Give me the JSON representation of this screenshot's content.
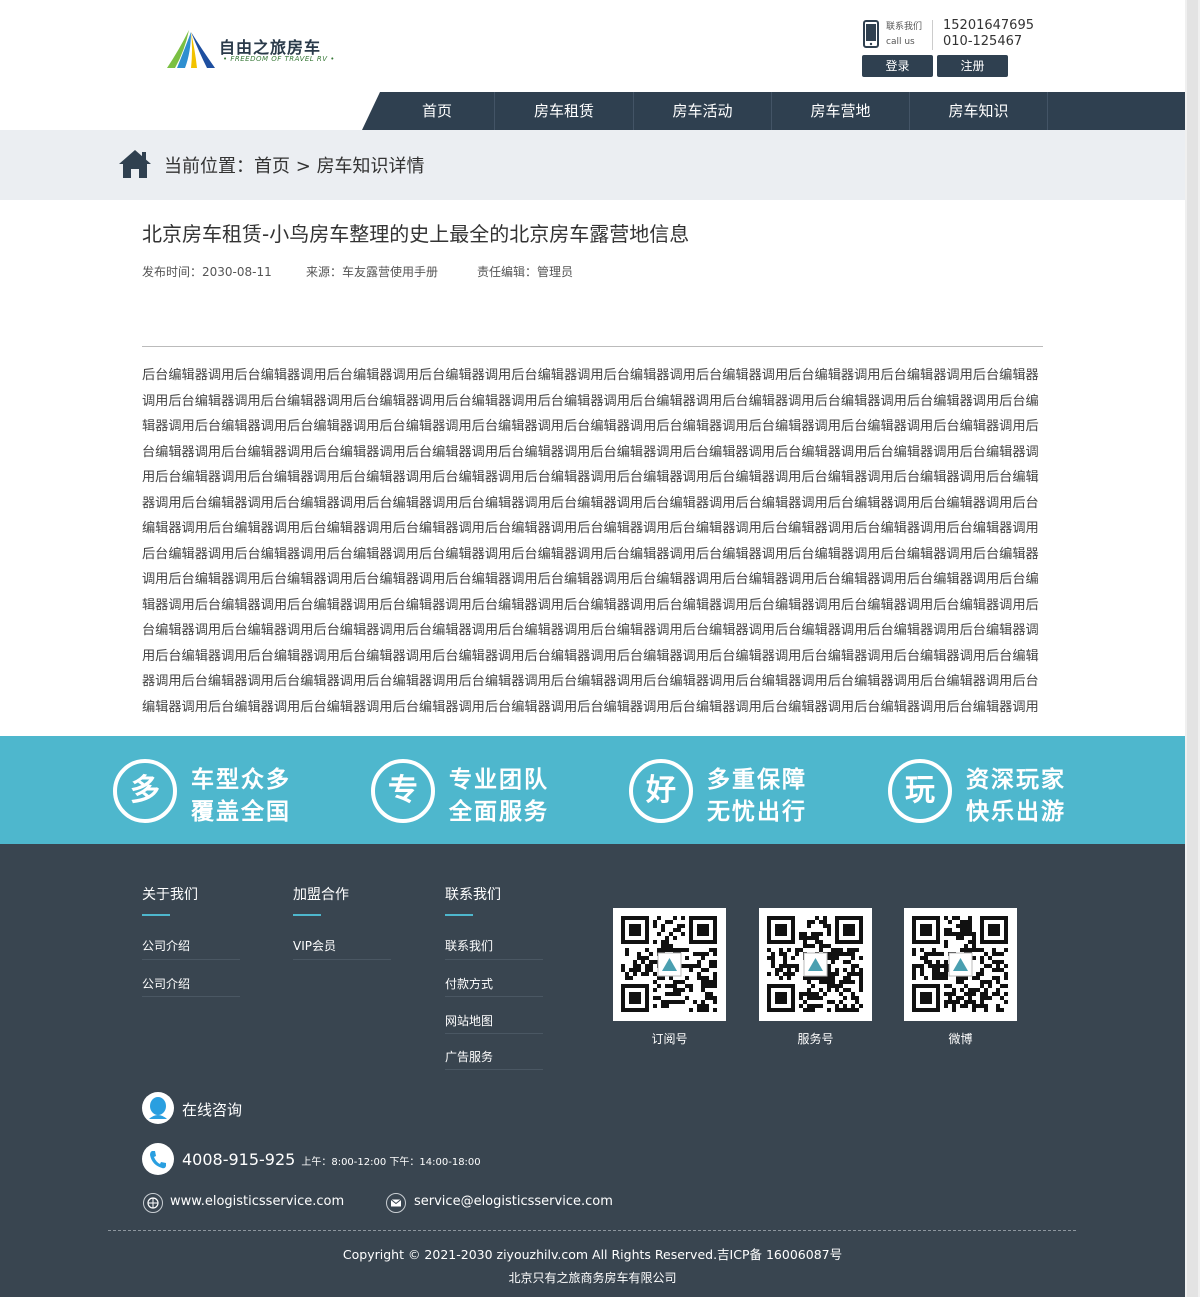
{
  "header": {
    "logo_text": "自由之旅房车",
    "logo_sub": "• FREEDOM OF TRAVEL RV •",
    "contact_label_cn": "联系我们",
    "contact_label_en": "call us",
    "phone1": "15201647695",
    "phone2": "010-125467",
    "login": "登录",
    "register": "注册"
  },
  "nav": {
    "items": [
      "首页",
      "房车租赁",
      "房车活动",
      "房车营地",
      "房车知识"
    ]
  },
  "breadcrumb": {
    "prefix": "当前位置：",
    "home": "首页",
    "sep": ">",
    "current": "房车知识详情"
  },
  "article": {
    "title": "北京房车租赁-小鸟房车整理的史上最全的北京房车露营地信息",
    "published": "发布时间：2030-08-11",
    "source": "来源：车友露营使用手册",
    "editor": "责任编辑：管理员",
    "body": "后台编辑器调用后台编辑器调用后台编辑器调用后台编辑器调用后台编辑器调用后台编辑器调用后台编辑器调用后台编辑器调用后台编辑器调用后台编辑器调用后台编辑器调用后台编辑器调用后台编辑器调用后台编辑器调用后台编辑器调用后台编辑器调用后台编辑器调用后台编辑器调用后台编辑器调用后台编辑器调用后台编辑器调用后台编辑器调用后台编辑器调用后台编辑器调用后台编辑器调用后台编辑器调用后台编辑器调用后台编辑器调用后台编辑器调用后台编辑器调用后台编辑器调用后台编辑器调用后台编辑器调用后台编辑器调用后台编辑器调用后台编辑器调用后台编辑器调用后台编辑器调用后台编辑器调用后台编辑器调用后台编辑器调用后台编辑器调用后台编辑器调用后台编辑器调用后台编辑器调用后台编辑器调用后台编辑器调用后台编辑器调用后台编辑器调用后台编辑器调用后台编辑器调用后台编辑器调用后台编辑器调用后台编辑器调用后台编辑器调用后台编辑器调用后台编辑器调用后台编辑器调用后台编辑器调用后台编辑器调用后台编辑器调用后台编辑器调用后台编辑器调用后台编辑器调用后台编辑器调用后台编辑器调用后台编辑器调用后台编辑器调用后台编辑器调用后台编辑器调用后台编辑器调用后台编辑器调用后台编辑器调用后台编辑器调用后台编辑器调用后台编辑器调用后台编辑器调用后台编辑器调用后台编辑器调用后台编辑器调用后台编辑器调用后台编辑器调用后台编辑器调用后台编辑器调用后台编辑器调用后台编辑器调用后台编辑器调用后台编辑器调用后台编辑器调用后台编辑器调用后台编辑器调用后台编辑器调用后台编辑器调用后台编辑器调用后台编辑器调用后台编辑器调用后台编辑器调用后台编辑器调用后台编辑器调用后台编辑器调用后台编辑器调用后台编辑器调用后台编辑器调用后台编辑器调用后台编辑器调用后台编辑器调用后台编辑器调用后台编辑器调用后台编辑器调用后台编辑器调用后台编辑器调用后台编辑器调用后台编辑器调用后台编辑器调用后台编辑器调用后台编辑器调用后台编辑器调用后台编辑器调用后台编辑器调用后台编辑器调用后台编辑器调用后台编辑器调用后台编辑器调用后台编辑器调用后台编辑器调用后台编辑器调用后台编辑器调用后台编辑器调用后台编辑器调用后台编辑器调用后台编辑器调用后台编辑器调用后台编辑器调用后台编辑器调用后台编辑器调用后台编辑器调用"
  },
  "features": [
    {
      "glyph": "多",
      "line1": "车型众多",
      "line2": "覆盖全国"
    },
    {
      "glyph": "专",
      "line1": "专业团队",
      "line2": "全面服务"
    },
    {
      "glyph": "好",
      "line1": "多重保障",
      "line2": "无忧出行"
    },
    {
      "glyph": "玩",
      "line1": "资深玩家",
      "line2": "快乐出游"
    }
  ],
  "footer": {
    "col1": {
      "title": "关于我们",
      "links": [
        "公司介绍",
        "公司介绍"
      ]
    },
    "col2": {
      "title": "加盟合作",
      "links": [
        "VIP会员"
      ]
    },
    "col3": {
      "title": "联系我们",
      "links": [
        "联系我们",
        "付款方式",
        "网站地图",
        "广告服务"
      ]
    },
    "qrs": [
      "订阅号",
      "服务号",
      "微博"
    ],
    "online": "在线咨询",
    "hotline": "4008-915-925",
    "hours": "上午：8:00-12:00   下午：14:00-18:00",
    "website": "www.elogisticsservice.com",
    "email": "service@elogisticsservice.com",
    "copyright": "Copyright © 2021-2030 ziyouzhilv.com All Rights Reserved.吉ICP备 16006087号",
    "company": "北京只有之旅商务房车有限公司"
  },
  "colors": {
    "nav_bg": "#2f4050",
    "accent": "#4eb7cd",
    "footer_bg": "#394550",
    "crumb_bg": "#ebeef2"
  }
}
